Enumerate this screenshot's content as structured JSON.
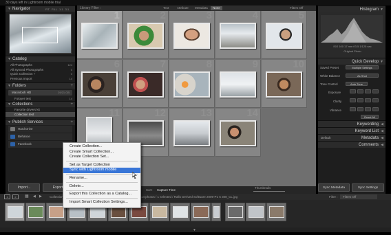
{
  "window_title": "30 days left in Lightroom mobile trial",
  "left": {
    "navigator": {
      "title": "Navigator",
      "options": "FIT  FILL  1:1  3:1"
    },
    "catalog": {
      "title": "Catalog",
      "items": [
        {
          "label": "All Photographs",
          "count": "124"
        },
        {
          "label": "All Synced Photographs",
          "count": "0"
        },
        {
          "label": "Quick Collection +",
          "count": "0"
        },
        {
          "label": "Previous Import",
          "count": "14"
        }
      ]
    },
    "folders": {
      "title": "Folders",
      "drive": "Macintosh HD",
      "drive_info": "29/21 GB",
      "folder": "Fotoyer test",
      "folder_count": "14"
    },
    "collections": {
      "title": "Collections",
      "items": [
        {
          "label": "Favorite drivers kit"
        },
        {
          "label": "Collection test"
        }
      ]
    },
    "publish": {
      "title": "Publish Services",
      "items": [
        {
          "label": "Hard Drive"
        },
        {
          "label": "Behance"
        },
        {
          "label": "Facebook"
        }
      ]
    },
    "buttons": {
      "import": "Import...",
      "export": "Export"
    }
  },
  "center": {
    "filter": {
      "label": "Library Filter :",
      "tabs": [
        "Text",
        "Attribute",
        "Metadata",
        "None"
      ],
      "active": "None",
      "status": "Filters Off"
    },
    "grid_numbers": [
      "1",
      "2",
      "3",
      "4",
      "5",
      "6",
      "7",
      "8",
      "9",
      "10",
      "11",
      "12",
      "13",
      "14"
    ],
    "toolbar": {
      "sort_label": "Sort:",
      "sort_value": "Capture Time",
      "thumbnails_label": "Thumbnails"
    }
  },
  "right": {
    "histogram": {
      "title": "Histogram",
      "readout": "ISO 100   17 mm   f/3.5   1/125 sec",
      "original": "Original Photo"
    },
    "quick_develop": {
      "title": "Quick Develop",
      "saved_preset_label": "Saved Preset",
      "saved_preset_value": "Multiple Settings",
      "white_balance_label": "White Balance",
      "white_balance_value": "As Shot",
      "tone_control_label": "Tone Control",
      "auto_tone": "Auto Tone",
      "sliders": [
        "Exposure",
        "Clarity",
        "Vibrance"
      ],
      "reset_all": "Reset All"
    },
    "panels": [
      "Keywording",
      "Keyword List",
      "Metadata",
      "Comments"
    ],
    "metadata_preset": "Default",
    "buttons": {
      "sync_metadata": "Sync Metadata",
      "sync_settings": "Sync Settings"
    }
  },
  "filmstrip": {
    "page1": "1",
    "page2": "2",
    "source": "Collection : Collection test",
    "info": "14 photos / 1 selected / Rallo Derived Software 2009-P1 5 308_CL.jpg",
    "filter_label": "Filter :",
    "filter_value": "Filters Off"
  },
  "context_menu": {
    "items": [
      "Create Collection...",
      "Create Smart Collection...",
      "Create Collection Set...",
      "Set as Target Collection",
      "Sync with Lightroom mobile",
      "Rename...",
      "Delete...",
      "Export this Collection as a Catalog...",
      "Import Smart Collection Settings..."
    ],
    "highlighted_index": 4
  },
  "colors": {
    "accent": "#3875d7",
    "panel": "#1e1e1e",
    "grid": "#6f6f6f"
  }
}
